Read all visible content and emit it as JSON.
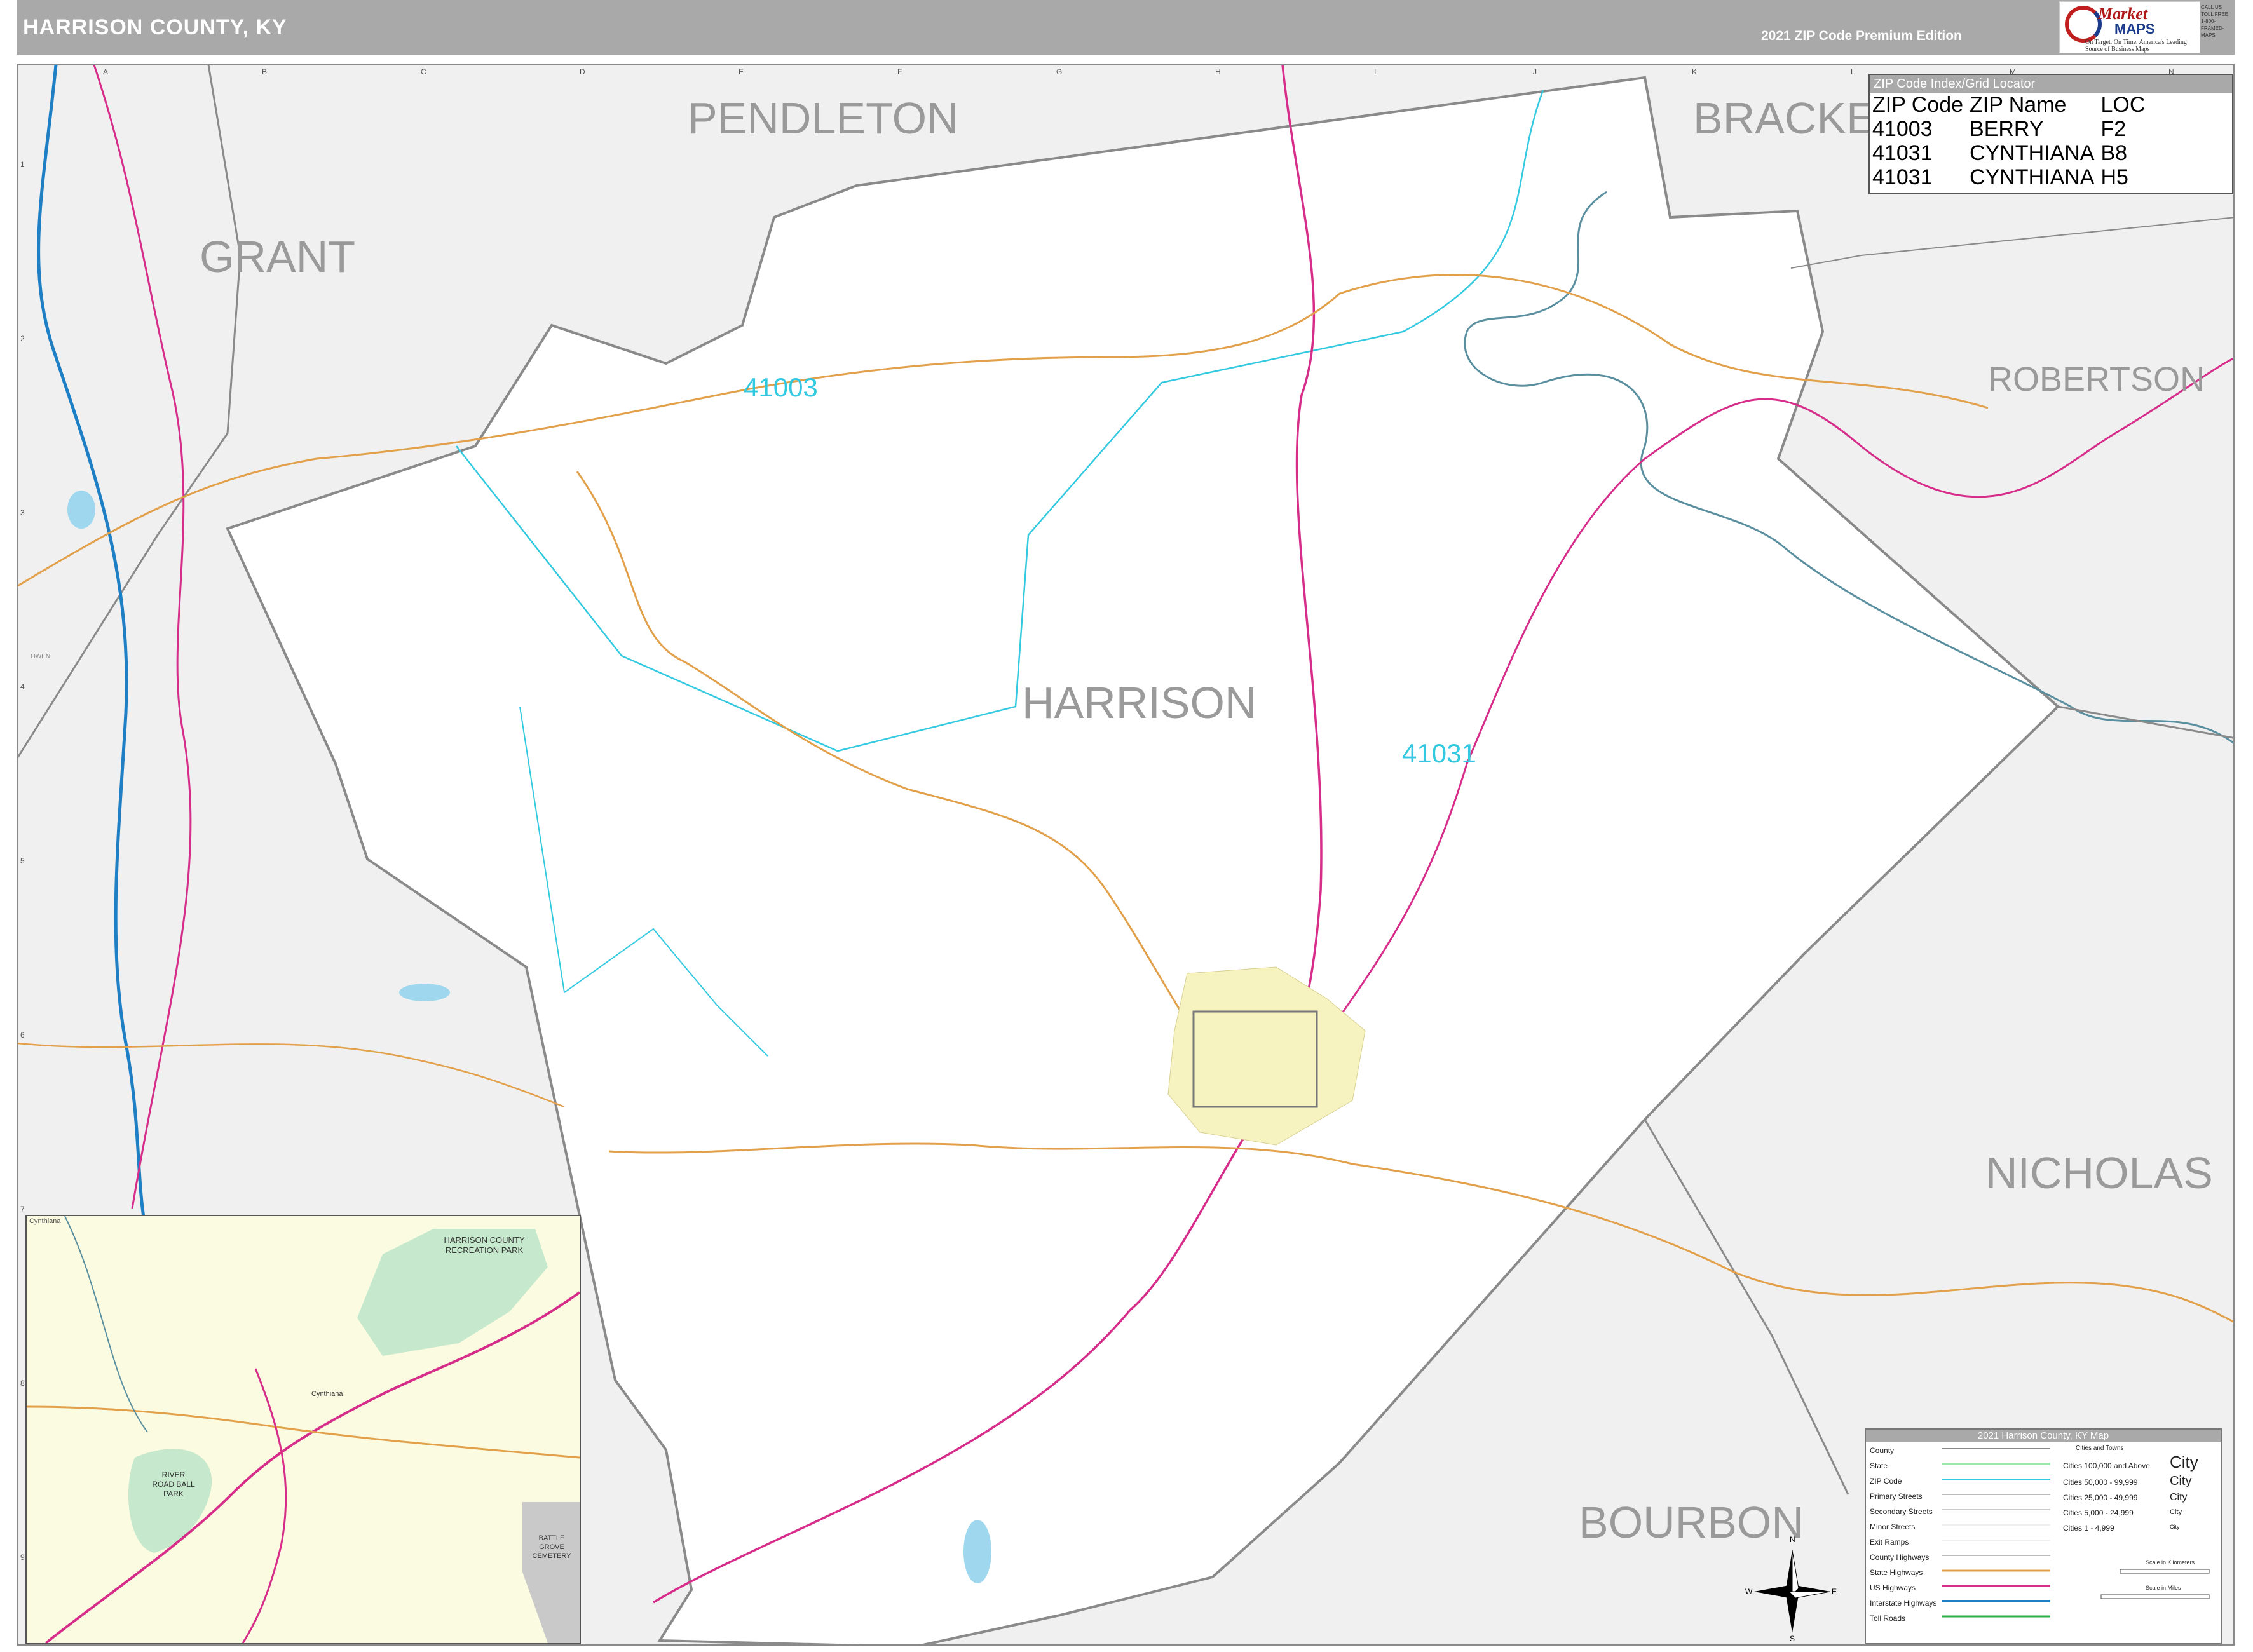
{
  "header": {
    "title": "HARRISON COUNTY, KY",
    "edition": "2021 ZIP Code Premium Edition"
  },
  "logo": {
    "brand_top": "Market",
    "brand_bottom": "MAPS",
    "tagline": "On Target, On Time. America's Leading Source of Business Maps",
    "call_text": "CALL US TOLL FREE 1-800-FRAMED-MAPS"
  },
  "grid": {
    "columns": [
      "A",
      "B",
      "C",
      "D",
      "E",
      "F",
      "G",
      "H",
      "I",
      "J",
      "K",
      "L",
      "M",
      "N"
    ],
    "rows": [
      "1",
      "2",
      "3",
      "4",
      "5",
      "6",
      "7",
      "8",
      "9"
    ]
  },
  "counties": {
    "main": "HARRISON",
    "neighbors": [
      "PENDLETON",
      "BRACKE",
      "GRANT",
      "ROBERTSON",
      "NICHOLAS",
      "BOURBON"
    ],
    "small": "OWEN"
  },
  "zip_labels": [
    "41003",
    "41031"
  ],
  "zip_index": {
    "title": "ZIP Code Index/Grid Locator",
    "headers": [
      "ZIP Code",
      "ZIP Name",
      "LOC"
    ],
    "rows": [
      [
        "41003",
        "BERRY",
        "F2"
      ],
      [
        "41031",
        "CYNTHIANA",
        "B8"
      ],
      [
        "41031",
        "CYNTHIANA",
        "H5"
      ]
    ]
  },
  "inset": {
    "title": "Cynthiana",
    "labels": [
      "HARRISON COUNTY RECREATION PARK",
      "RIVER ROAD BALL PARK",
      "BATTLE GROVE CEMETERY",
      "Cynthiana"
    ]
  },
  "legend": {
    "title": "2021 Harrison County, KY Map",
    "items": [
      "County",
      "State",
      "ZIP Code",
      "Primary Streets",
      "Secondary Streets",
      "Minor Streets",
      "Exit Ramps",
      "County Highways",
      "State Highways",
      "US Highways",
      "Interstate Highways",
      "Toll Roads"
    ],
    "cities_header": "Cities and Towns",
    "cities": [
      "Cities 100,000 and Above",
      "Cities 50,000 - 99,999",
      "Cities 25,000 - 49,999",
      "Cities 5,000 - 24,999",
      "Cities 1 - 4,999"
    ],
    "city_samples": [
      "City",
      "City",
      "City",
      "City",
      "City"
    ],
    "scale_km": "Scale in Kilometers",
    "scale_mi": "Scale in Miles"
  },
  "compass": {
    "n": "N",
    "s": "S",
    "e": "E",
    "w": "W"
  },
  "colors": {
    "header": "#a9a9a9",
    "zip": "#33c9e0",
    "us_highway": "#d62d8a",
    "state_highway": "#e2a04a",
    "interstate": "#1f7fc4",
    "county_border": "#8a8a8a",
    "river": "#5a8fa0"
  }
}
